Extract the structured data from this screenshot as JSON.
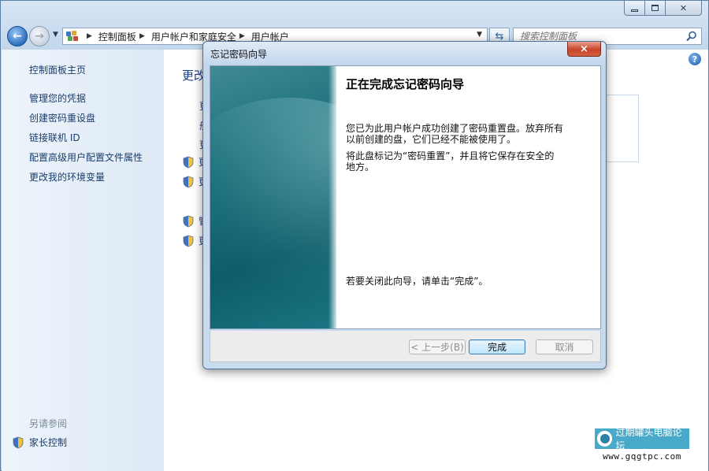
{
  "navigation": {
    "breadcrumbs": [
      "控制面板",
      "用户帐户和家庭安全",
      "用户帐户"
    ],
    "search_placeholder": "搜索控制面板"
  },
  "sidebar": {
    "items": [
      {
        "label": "控制面板主页"
      },
      {
        "label": "管理您的凭据"
      },
      {
        "label": "创建密码重设盘"
      },
      {
        "label": "链接联机 ID"
      },
      {
        "label": "配置高级用户配置文件属性"
      },
      {
        "label": "更改我的环境变量"
      }
    ],
    "see_also": "另请参阅",
    "parental_controls": "家长控制"
  },
  "main": {
    "title_fragment": "更改",
    "link_fragments": [
      "更",
      "册",
      "更"
    ],
    "shield_fragments": [
      "更",
      "更",
      "管",
      "更"
    ]
  },
  "dialog": {
    "title": "忘记密码向导",
    "close_glyph": "×",
    "heading": "正在完成忘记密码向导",
    "para1_line1": "您已为此用户帐户成功创建了密码重置盘。放弃所有",
    "para1_line2": "以前创建的盘，它们已经不能被使用了。",
    "para2_line1": "将此盘标记为“密码重置”，并且将它保存在安全的",
    "para2_line2": "地方。",
    "closing": "若要关闭此向导，请单击“完成”。",
    "buttons": {
      "back": "< 上一步(B)",
      "finish": "完成",
      "cancel": "取消"
    }
  },
  "watermark": {
    "title": "过期罐头电脑论坛",
    "url": "www.gqgtpc.com"
  },
  "colors": {
    "link": "#1a3d6b",
    "panel_teal": "#1a6f7a",
    "watermark_blue": "#49a9c9"
  }
}
